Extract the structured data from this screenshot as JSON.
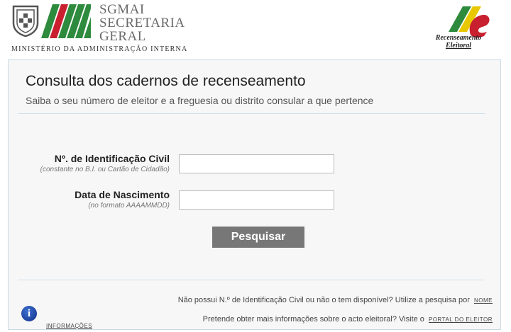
{
  "header": {
    "org_lines": [
      "SGMAI",
      "SECRETARIA",
      "GERAL"
    ],
    "ministry": "MINISTÉRIO DA ADMINISTRAÇÃO INTERNA",
    "recenseamento_lines": [
      "Recenseamento",
      "Eleitoral"
    ]
  },
  "main": {
    "title": "Consulta dos cadernos de recenseamento",
    "subtitle": "Saiba o seu número de eleitor e a freguesia ou distrito consular a que pertence"
  },
  "form": {
    "id_label": "Nº. de Identificação Civil",
    "id_hint": "(constante no B.I. ou Cartão de Cidadão)",
    "id_value": "",
    "dob_label": "Data de Nascimento",
    "dob_hint": "(no formato AAAAMMDD)",
    "dob_value": "",
    "submit_label": "Pesquisar"
  },
  "footer": {
    "no_id_text": "Não possui N.º de Identificação Civil ou não o tem disponível? Utilize a pesquisa por",
    "no_id_link": "Nome",
    "more_info_text": "Pretende obter mais informações sobre o acto eleitoral? Visite o",
    "portal_link": "Portal do Eleitor",
    "info_link": "Informações"
  },
  "colors": {
    "green": "#2e8b3d",
    "red": "#c8202f",
    "button": "#777777",
    "info": "#1a3d9a"
  }
}
